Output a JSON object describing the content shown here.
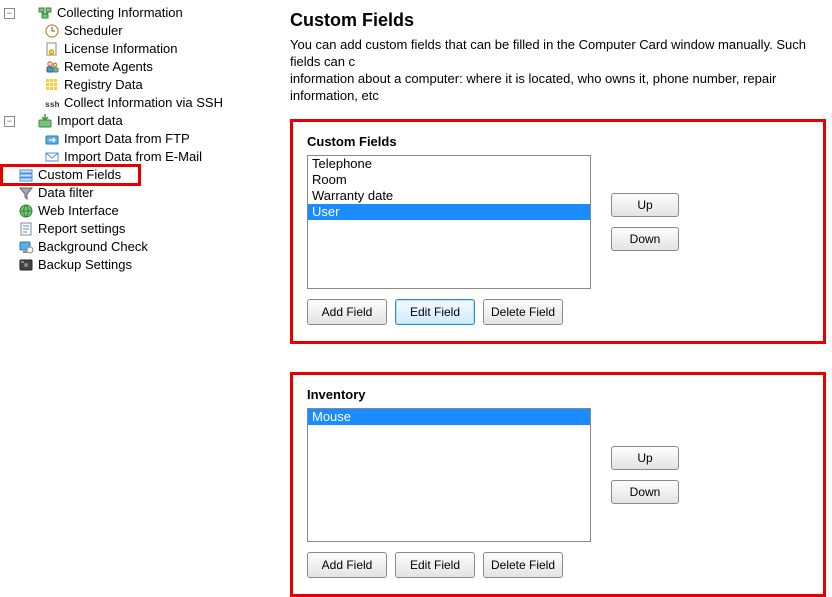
{
  "sidebar": {
    "items": [
      {
        "label": "Collecting Information",
        "level": 0,
        "expanded": true,
        "icon": "collect"
      },
      {
        "label": "Scheduler",
        "level": 1,
        "icon": "clock"
      },
      {
        "label": "License Information",
        "level": 1,
        "icon": "license"
      },
      {
        "label": "Remote Agents",
        "level": 1,
        "icon": "agents"
      },
      {
        "label": "Registry Data",
        "level": 1,
        "icon": "registry"
      },
      {
        "label": "Collect Information via SSH",
        "level": 1,
        "icon": "ssh"
      },
      {
        "label": "Import data",
        "level": 0,
        "expanded": true,
        "icon": "import"
      },
      {
        "label": "Import Data from FTP",
        "level": 1,
        "icon": "ftp"
      },
      {
        "label": "Import Data from E-Mail",
        "level": 1,
        "icon": "mail"
      },
      {
        "label": "Custom Fields",
        "level": 0,
        "icon": "fields",
        "boxed": true
      },
      {
        "label": "Data filter",
        "level": 0,
        "icon": "filter"
      },
      {
        "label": "Web Interface",
        "level": 0,
        "icon": "web"
      },
      {
        "label": "Report settings",
        "level": 0,
        "icon": "report"
      },
      {
        "label": "Background Check",
        "level": 0,
        "icon": "bgcheck"
      },
      {
        "label": "Backup Settings",
        "level": 0,
        "icon": "backup"
      }
    ]
  },
  "page": {
    "title": "Custom Fields",
    "desc1": "You can add custom fields that can be filled in the Computer Card window manually. Such fields can c",
    "desc2": "information about a computer: where it is located, who owns it, phone number, repair information, etc"
  },
  "panels": [
    {
      "title": "Custom Fields",
      "items": [
        {
          "label": "Telephone",
          "selected": false
        },
        {
          "label": "Room",
          "selected": false
        },
        {
          "label": "Warranty date",
          "selected": false
        },
        {
          "label": "User",
          "selected": true
        }
      ],
      "btns": {
        "up": "Up",
        "down": "Down",
        "add": "Add Field",
        "edit": "Edit Field",
        "del": "Delete Field"
      },
      "highlight_edit": true
    },
    {
      "title": "Inventory",
      "items": [
        {
          "label": "Mouse",
          "selected": true
        }
      ],
      "btns": {
        "up": "Up",
        "down": "Down",
        "add": "Add Field",
        "edit": "Edit Field",
        "del": "Delete Field"
      },
      "highlight_edit": false
    }
  ],
  "icons": {
    "collect": "collect",
    "clock": "clock",
    "license": "license",
    "agents": "agents",
    "registry": "registry",
    "ssh": "ssh",
    "import": "import",
    "ftp": "ftp",
    "mail": "mail",
    "fields": "fields",
    "filter": "filter",
    "web": "web",
    "report": "report",
    "bgcheck": "bgcheck",
    "backup": "backup"
  }
}
